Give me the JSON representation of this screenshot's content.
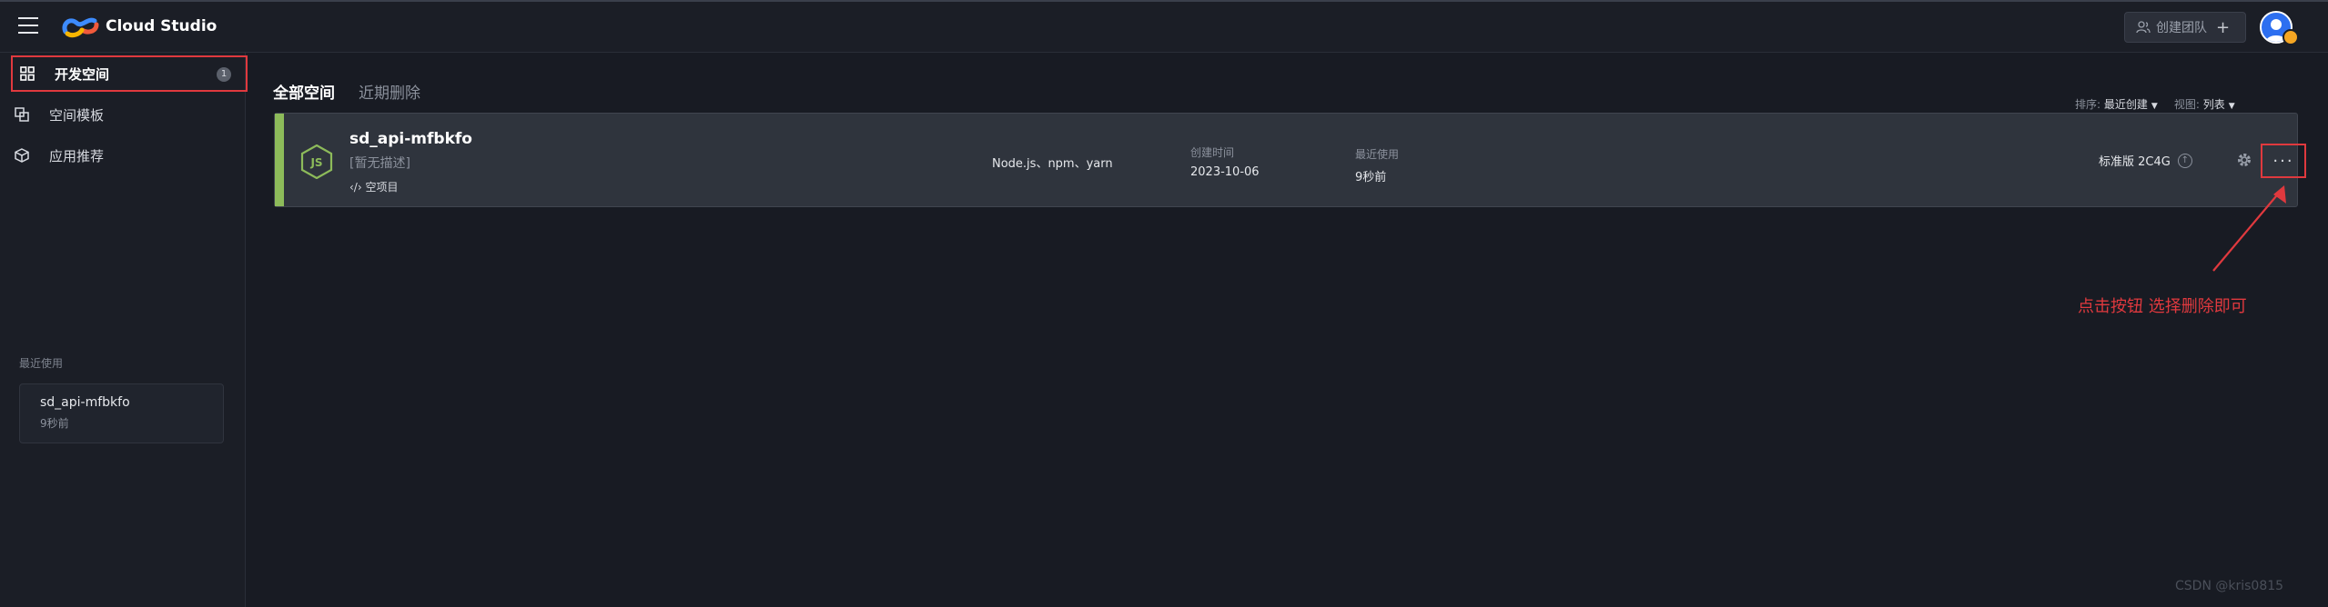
{
  "app": {
    "title": "Cloud Studio"
  },
  "header": {
    "create_team_label": "创建团队",
    "icons": [
      "menu-icon",
      "cloud-studio-logo",
      "team-icon",
      "plus-icon",
      "avatar"
    ]
  },
  "sidebar": {
    "items": [
      {
        "label": "开发空间",
        "count": "1",
        "active": true,
        "icon": "grid-icon"
      },
      {
        "label": "空间模板",
        "icon": "copy-icon"
      },
      {
        "label": "应用推荐",
        "icon": "cube-icon"
      }
    ],
    "recent_title": "最近使用",
    "recent_items": [
      {
        "name": "sd_api-mfbkfo",
        "time": "9秒前"
      }
    ]
  },
  "main": {
    "tabs": [
      {
        "label": "全部空间",
        "active": true
      },
      {
        "label": "近期删除",
        "active": false
      }
    ],
    "sort_label": "排序:",
    "sort_value": "最近创建",
    "view_label": "视图:",
    "view_value": "列表"
  },
  "workspace": {
    "name": "sd_api-mfbkfo",
    "description": "[暂无描述]",
    "project_type": "‹/› 空项目",
    "stack": "Node.js、npm、yarn",
    "created_label": "创建时间",
    "created_value": "2023-10-06",
    "used_label": "最近使用",
    "used_value": "9秒前",
    "spec": "标准版 2C4G",
    "icon": "nodejs-icon",
    "accent_color": "#8dbb5a"
  },
  "annotation": {
    "text": "点击按钮 选择删除即可",
    "color": "#e0393e"
  },
  "watermark": "CSDN @kris0815"
}
